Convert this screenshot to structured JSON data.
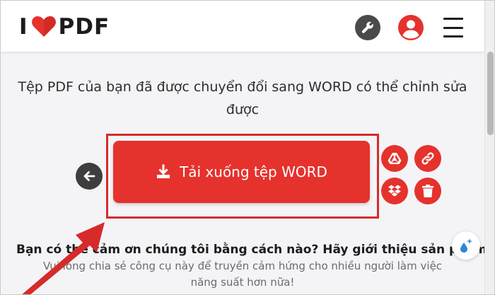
{
  "header": {
    "logo_left": "I",
    "logo_right": "PDF",
    "icons": {
      "logo": "heart-icon",
      "tools": "wrench-icon",
      "account": "user-icon",
      "menu": "hamburger-menu-icon"
    }
  },
  "main": {
    "result_message": "Tệp PDF của bạn đã được chuyển đổi sang WORD có thể chỉnh sửa được",
    "download_label": "Tải xuống tệp WORD",
    "side_actions": [
      "google-drive-icon",
      "link-icon",
      "dropbox-icon",
      "trash-icon"
    ],
    "promo_title": "Bạn có thể cảm ơn chúng tôi bằng cách nào? Hãy giới thiệu sản phẩm này",
    "promo_subtitle": "Vui lòng chia sẻ công cụ này để truyền cảm hứng cho nhiều người làm việc năng suất hơn nữa!"
  },
  "colors": {
    "brand_red": "#e5322d",
    "annotation_red": "#d62b2b",
    "dark_icon": "#3e3e3e"
  }
}
